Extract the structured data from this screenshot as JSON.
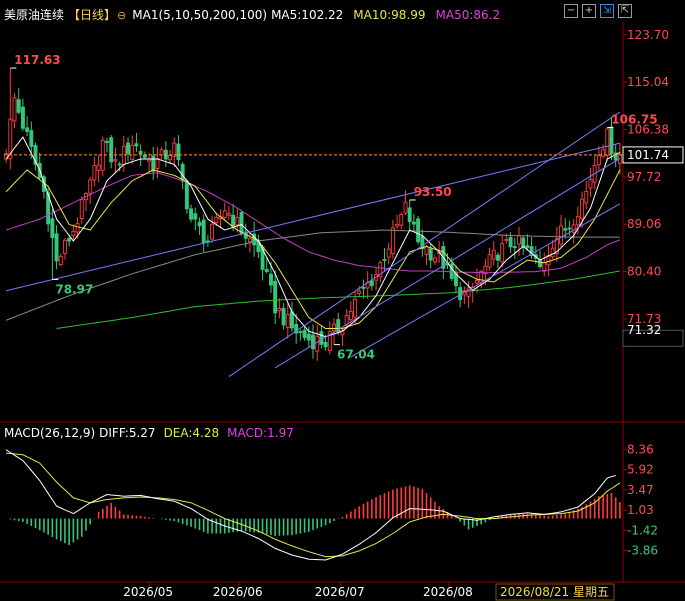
{
  "header": {
    "title": "美原油连续",
    "period": "【日线】",
    "ma_label": "MA1(5,10,50,200,100)",
    "ma5": "MA5:102.22",
    "ma10": "MA10:98.99",
    "ma50": "MA50:86.2"
  },
  "macd_header": {
    "label": "MACD(26,12,9)",
    "diff": "DIFF:5.27",
    "dea": "DEA:4.28",
    "macd": "MACD:1.97"
  },
  "toolbar": {
    "icons": [
      "minus-icon",
      "plus-icon",
      "collapse-icon",
      "expand-icon"
    ]
  },
  "colors": {
    "up": "#ff3b3b",
    "down": "#34c77b",
    "ma5": "#ffffff",
    "ma10": "#e6e64a",
    "ma50": "#c040c0",
    "ma100": "#8a8a8a",
    "ma200": "#2fbf2f",
    "trendline": "#7a7aff",
    "price_line": "#ff9933"
  },
  "chart_data": [
    {
      "type": "candlestick",
      "title": "美原油连续",
      "y_ticks": [
        "123.70",
        "115.04",
        "106.38",
        "97.72",
        "89.06",
        "80.40",
        "71.73"
      ],
      "ylim": [
        63.5,
        125.5
      ],
      "x_ticks": [
        "2026/05",
        "2026/06",
        "2026/07",
        "2026/08"
      ],
      "cursor_date": "2026/08/21 星期五",
      "last_price": "101.74",
      "bottom_price": "71.32",
      "annotations": [
        {
          "label": "117.63",
          "value": 117.63,
          "bar": 1,
          "kind": "high"
        },
        {
          "label": "78.97",
          "value": 78.97,
          "bar": 11,
          "kind": "low"
        },
        {
          "label": "93.50",
          "value": 93.5,
          "bar": 96,
          "kind": "high"
        },
        {
          "label": "67.04",
          "value": 67.04,
          "bar": 78,
          "kind": "low"
        },
        {
          "label": "106.75",
          "value": 106.75,
          "bar": 143,
          "kind": "high"
        }
      ],
      "close_path": [
        [
          0,
          103
        ],
        [
          2,
          112
        ],
        [
          5,
          105
        ],
        [
          9,
          95
        ],
        [
          12,
          82
        ],
        [
          16,
          88
        ],
        [
          20,
          96
        ],
        [
          23,
          104
        ],
        [
          26,
          100
        ],
        [
          30,
          104
        ],
        [
          35,
          100
        ],
        [
          40,
          103
        ],
        [
          44,
          90
        ],
        [
          48,
          86
        ],
        [
          52,
          92
        ],
        [
          56,
          88
        ],
        [
          60,
          84
        ],
        [
          64,
          74
        ],
        [
          68,
          70
        ],
        [
          72,
          68
        ],
        [
          76,
          67.5
        ],
        [
          80,
          71
        ],
        [
          84,
          76
        ],
        [
          88,
          80
        ],
        [
          92,
          87
        ],
        [
          95,
          92
        ],
        [
          98,
          86
        ],
        [
          101,
          84
        ],
        [
          104,
          82
        ],
        [
          107,
          77
        ],
        [
          110,
          76
        ],
        [
          113,
          80
        ],
        [
          117,
          84
        ],
        [
          121,
          86
        ],
        [
          124,
          84
        ],
        [
          127,
          81
        ],
        [
          130,
          86
        ],
        [
          134,
          89
        ],
        [
          138,
          95
        ],
        [
          141,
          103
        ],
        [
          143,
          105
        ],
        [
          145,
          101.7
        ]
      ],
      "ma5_path": [
        [
          0,
          101
        ],
        [
          4,
          105
        ],
        [
          8,
          99
        ],
        [
          12,
          90
        ],
        [
          16,
          86
        ],
        [
          20,
          90
        ],
        [
          24,
          97
        ],
        [
          28,
          100
        ],
        [
          32,
          101
        ],
        [
          36,
          101
        ],
        [
          40,
          100
        ],
        [
          44,
          96
        ],
        [
          48,
          90
        ],
        [
          52,
          88
        ],
        [
          56,
          89
        ],
        [
          60,
          86
        ],
        [
          64,
          80
        ],
        [
          68,
          73
        ],
        [
          72,
          69.5
        ],
        [
          76,
          68.5
        ],
        [
          80,
          69.5
        ],
        [
          84,
          72
        ],
        [
          88,
          76
        ],
        [
          92,
          82
        ],
        [
          96,
          88
        ],
        [
          99,
          87
        ],
        [
          103,
          84
        ],
        [
          107,
          80
        ],
        [
          111,
          77
        ],
        [
          115,
          79
        ],
        [
          119,
          82.5
        ],
        [
          123,
          85
        ],
        [
          127,
          82.5
        ],
        [
          131,
          84
        ],
        [
          135,
          87
        ],
        [
          139,
          92
        ],
        [
          143,
          101
        ],
        [
          146,
          102.2
        ]
      ],
      "ma10_path": [
        [
          0,
          95
        ],
        [
          5,
          99
        ],
        [
          10,
          96
        ],
        [
          15,
          89
        ],
        [
          20,
          88
        ],
        [
          25,
          93
        ],
        [
          30,
          97
        ],
        [
          35,
          99
        ],
        [
          40,
          98
        ],
        [
          45,
          96
        ],
        [
          50,
          91
        ],
        [
          55,
          88
        ],
        [
          60,
          86
        ],
        [
          64,
          82
        ],
        [
          68,
          77
        ],
        [
          72,
          72
        ],
        [
          76,
          70
        ],
        [
          80,
          70
        ],
        [
          84,
          71
        ],
        [
          88,
          74
        ],
        [
          92,
          79
        ],
        [
          96,
          84
        ],
        [
          100,
          85
        ],
        [
          104,
          84
        ],
        [
          108,
          80.5
        ],
        [
          112,
          79
        ],
        [
          116,
          78.5
        ],
        [
          120,
          80.5
        ],
        [
          124,
          82.5
        ],
        [
          128,
          82
        ],
        [
          132,
          83
        ],
        [
          136,
          85.5
        ],
        [
          140,
          90
        ],
        [
          144,
          96
        ],
        [
          146,
          99
        ]
      ],
      "ma50_path": [
        [
          0,
          88
        ],
        [
          8,
          90
        ],
        [
          16,
          93
        ],
        [
          24,
          96
        ],
        [
          30,
          98
        ],
        [
          36,
          98.5
        ],
        [
          42,
          97
        ],
        [
          48,
          95
        ],
        [
          54,
          92.5
        ],
        [
          60,
          89.5
        ],
        [
          66,
          86.5
        ],
        [
          72,
          84
        ],
        [
          78,
          82.5
        ],
        [
          84,
          81.5
        ],
        [
          90,
          81
        ],
        [
          96,
          80.5
        ],
        [
          102,
          80.5
        ],
        [
          108,
          80.3
        ],
        [
          114,
          80.2
        ],
        [
          120,
          80.3
        ],
        [
          126,
          80.4
        ],
        [
          132,
          81
        ],
        [
          138,
          83
        ],
        [
          143,
          85.3
        ],
        [
          146,
          86.2
        ]
      ],
      "ma100_path": [
        [
          0,
          71.5
        ],
        [
          15,
          76
        ],
        [
          30,
          80
        ],
        [
          45,
          83.5
        ],
        [
          60,
          86
        ],
        [
          75,
          87.5
        ],
        [
          90,
          88
        ],
        [
          105,
          87.6
        ],
        [
          120,
          87
        ],
        [
          135,
          86.7
        ],
        [
          146,
          86.7
        ]
      ],
      "ma200_path": [
        [
          12,
          70
        ],
        [
          30,
          72
        ],
        [
          45,
          74
        ],
        [
          60,
          75
        ],
        [
          75,
          75.6
        ],
        [
          90,
          76
        ],
        [
          105,
          76.5
        ],
        [
          120,
          77.5
        ],
        [
          135,
          79
        ],
        [
          146,
          80.5
        ]
      ],
      "trendlines": [
        {
          "from": [
            0,
            76.9
          ],
          "to": [
            146,
            103.9
          ]
        },
        {
          "from": [
            53,
            61.2
          ],
          "to": [
            146,
            109.6
          ]
        },
        {
          "from": [
            64,
            62.8
          ],
          "to": [
            146,
            101.1
          ]
        },
        {
          "from": [
            82,
            64.8
          ],
          "to": [
            146,
            92.8
          ]
        }
      ]
    },
    {
      "type": "bar",
      "title": "MACD(26,12,9)",
      "y_ticks": [
        "8.36",
        "5.92",
        "3.47",
        "1.03",
        "-1.42",
        "-3.86"
      ],
      "ylim": [
        -5.0,
        9.0
      ],
      "diff_path": [
        [
          0,
          8.3
        ],
        [
          4,
          7.0
        ],
        [
          8,
          4.6
        ],
        [
          12,
          1.5
        ],
        [
          16,
          0.6
        ],
        [
          20,
          1.9
        ],
        [
          24,
          2.9
        ],
        [
          28,
          2.7
        ],
        [
          32,
          2.8
        ],
        [
          36,
          2.4
        ],
        [
          40,
          2.1
        ],
        [
          44,
          1.2
        ],
        [
          48,
          -0.1
        ],
        [
          52,
          -0.9
        ],
        [
          56,
          -1.5
        ],
        [
          60,
          -2.4
        ],
        [
          64,
          -3.6
        ],
        [
          68,
          -4.4
        ],
        [
          72,
          -4.9
        ],
        [
          76,
          -5.0
        ],
        [
          80,
          -4.3
        ],
        [
          84,
          -3.1
        ],
        [
          88,
          -1.7
        ],
        [
          92,
          0.1
        ],
        [
          96,
          1.2
        ],
        [
          100,
          1.1
        ],
        [
          104,
          0.9
        ],
        [
          108,
          0.0
        ],
        [
          112,
          -0.2
        ],
        [
          116,
          0.2
        ],
        [
          120,
          0.5
        ],
        [
          124,
          0.7
        ],
        [
          128,
          0.5
        ],
        [
          132,
          0.8
        ],
        [
          136,
          1.4
        ],
        [
          140,
          3.0
        ],
        [
          143,
          4.9
        ],
        [
          145,
          5.2
        ]
      ],
      "dea_path": [
        [
          0,
          7.9
        ],
        [
          4,
          7.7
        ],
        [
          8,
          6.7
        ],
        [
          12,
          4.4
        ],
        [
          16,
          2.5
        ],
        [
          20,
          1.9
        ],
        [
          24,
          2.3
        ],
        [
          28,
          2.5
        ],
        [
          32,
          2.6
        ],
        [
          36,
          2.5
        ],
        [
          40,
          2.3
        ],
        [
          44,
          1.9
        ],
        [
          48,
          1.0
        ],
        [
          52,
          0.0
        ],
        [
          56,
          -0.7
        ],
        [
          60,
          -1.5
        ],
        [
          64,
          -2.5
        ],
        [
          68,
          -3.3
        ],
        [
          72,
          -4.0
        ],
        [
          76,
          -4.6
        ],
        [
          80,
          -4.5
        ],
        [
          84,
          -3.9
        ],
        [
          88,
          -3.0
        ],
        [
          92,
          -1.8
        ],
        [
          96,
          -0.4
        ],
        [
          100,
          0.2
        ],
        [
          104,
          0.5
        ],
        [
          108,
          0.3
        ],
        [
          112,
          0.0
        ],
        [
          116,
          0.0
        ],
        [
          120,
          0.2
        ],
        [
          124,
          0.4
        ],
        [
          128,
          0.5
        ],
        [
          132,
          0.6
        ],
        [
          136,
          0.9
        ],
        [
          140,
          1.9
        ],
        [
          143,
          3.3
        ],
        [
          146,
          4.3
        ]
      ],
      "histogram_path": [
        [
          0,
          0
        ],
        [
          4,
          -0.4
        ],
        [
          8,
          -1.4
        ],
        [
          12,
          -2.5
        ],
        [
          15,
          -3.2
        ],
        [
          18,
          -2.2
        ],
        [
          22,
          0.8
        ],
        [
          25,
          1.9
        ],
        [
          28,
          0.5
        ],
        [
          32,
          0.3
        ],
        [
          36,
          0.0
        ],
        [
          40,
          -0.3
        ],
        [
          44,
          -1.0
        ],
        [
          48,
          -1.8
        ],
        [
          52,
          -1.8
        ],
        [
          56,
          -1.5
        ],
        [
          60,
          -1.7
        ],
        [
          64,
          -2.1
        ],
        [
          68,
          -2.0
        ],
        [
          72,
          -1.6
        ],
        [
          76,
          -0.8
        ],
        [
          80,
          0.2
        ],
        [
          84,
          1.5
        ],
        [
          88,
          2.6
        ],
        [
          92,
          3.5
        ],
        [
          96,
          4.0
        ],
        [
          99,
          3.6
        ],
        [
          103,
          1.5
        ],
        [
          107,
          0.1
        ],
        [
          110,
          -1.3
        ],
        [
          113,
          -0.7
        ],
        [
          117,
          0.3
        ],
        [
          121,
          0.5
        ],
        [
          125,
          0.6
        ],
        [
          129,
          0.3
        ],
        [
          133,
          0.6
        ],
        [
          137,
          1.4
        ],
        [
          141,
          2.7
        ],
        [
          144,
          3.1
        ],
        [
          146,
          2.0
        ]
      ]
    }
  ]
}
